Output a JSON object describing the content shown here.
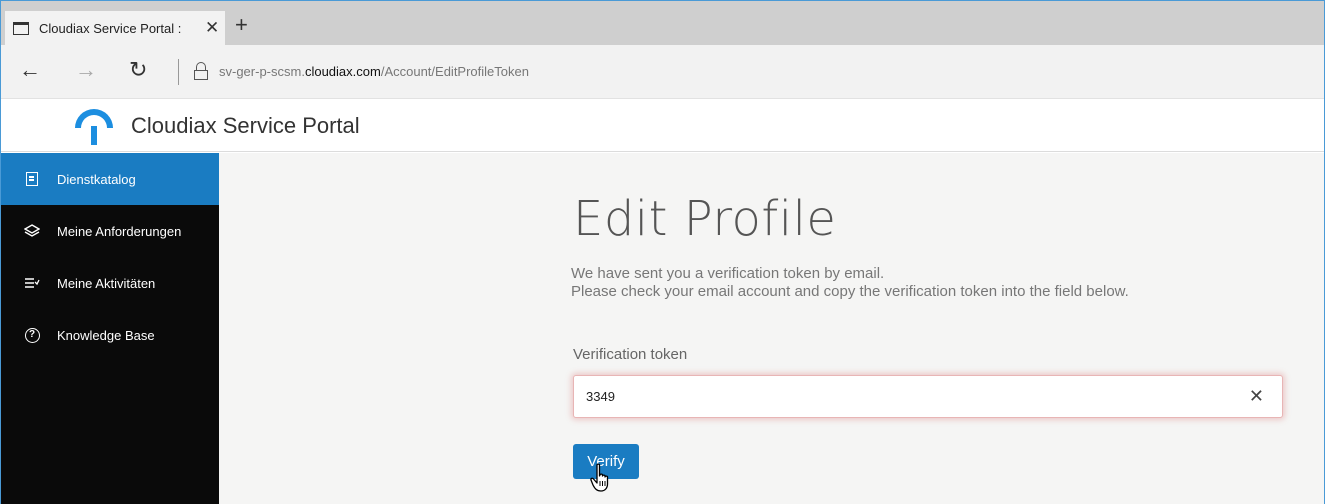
{
  "browser": {
    "tab_title": "Cloudiax Service Portal : ",
    "close_glyph": "✕",
    "new_tab_glyph": "+",
    "back_glyph": "←",
    "forward_glyph": "→",
    "reload_glyph": "↻",
    "url_prefix": "sv-ger-p-scsm.",
    "url_domain": "cloudiax.com",
    "url_path": "/Account/EditProfileToken"
  },
  "header": {
    "title": "Cloudiax Service Portal",
    "brand_color": "#1c8ee0"
  },
  "sidebar": {
    "items": [
      {
        "label": "Dienstkatalog",
        "icon": "book-icon",
        "active": true
      },
      {
        "label": "Meine Anforderungen",
        "icon": "layers-icon"
      },
      {
        "label": "Meine Aktivitäten",
        "icon": "checklist-icon"
      },
      {
        "label": "Knowledge Base",
        "icon": "help-icon"
      }
    ],
    "active_color": "#1a7cc2"
  },
  "main": {
    "title": "Edit Profile",
    "description_line1": "We have sent you a verification token by email.",
    "description_line2": "Please check your email account and copy the verification token into the field below.",
    "token_label": "Verification token",
    "token_value": "3349",
    "clear_glyph": "✕",
    "verify_label": "Verify"
  }
}
